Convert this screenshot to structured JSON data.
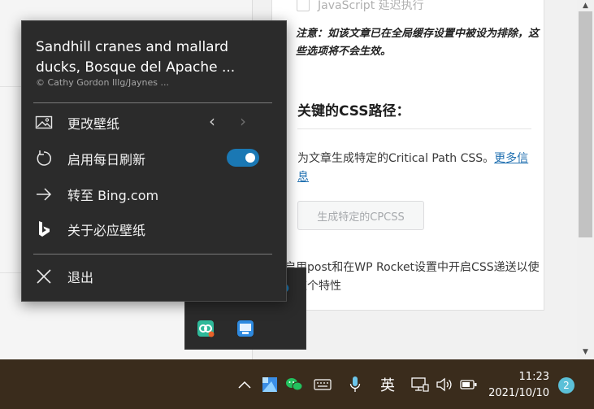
{
  "background": {
    "js_option_label": "JavaScript 延迟执行",
    "note": "注意：如该文章已在全局缓存设置中被设为排除，这些选项将不会生效。",
    "css_title": "关键的CSS路径：",
    "css_desc": "为文章生成特定的Critical Path CSS。",
    "css_more_link": "更多信息",
    "generate_button": "生成特定的CPCSS",
    "bottom_text": "启用post和在WP Rocket设置中开启CSS递送以使用这个特性"
  },
  "menu": {
    "title": "Sandhill cranes and mallard ducks, Bosque del Apache ...",
    "credit": "© Cathy   Gordon Illg/Jaynes ...",
    "items": [
      {
        "label": "更改壁纸",
        "icon": "wallpaper-icon"
      },
      {
        "label": "启用每日刷新",
        "icon": "refresh-icon"
      },
      {
        "label": "转至 Bing.com",
        "icon": "arrow-right-icon"
      },
      {
        "label": "关于必应壁纸",
        "icon": "bing-logo-icon"
      },
      {
        "label": "退出",
        "icon": "close-icon"
      }
    ],
    "daily_refresh_enabled": true
  },
  "taskbar": {
    "ime_label": "英",
    "time": "11:23",
    "date": "2021/10/10",
    "notification_count": "2",
    "accent": "#1a78b4",
    "bg": "#3a2c1c"
  }
}
